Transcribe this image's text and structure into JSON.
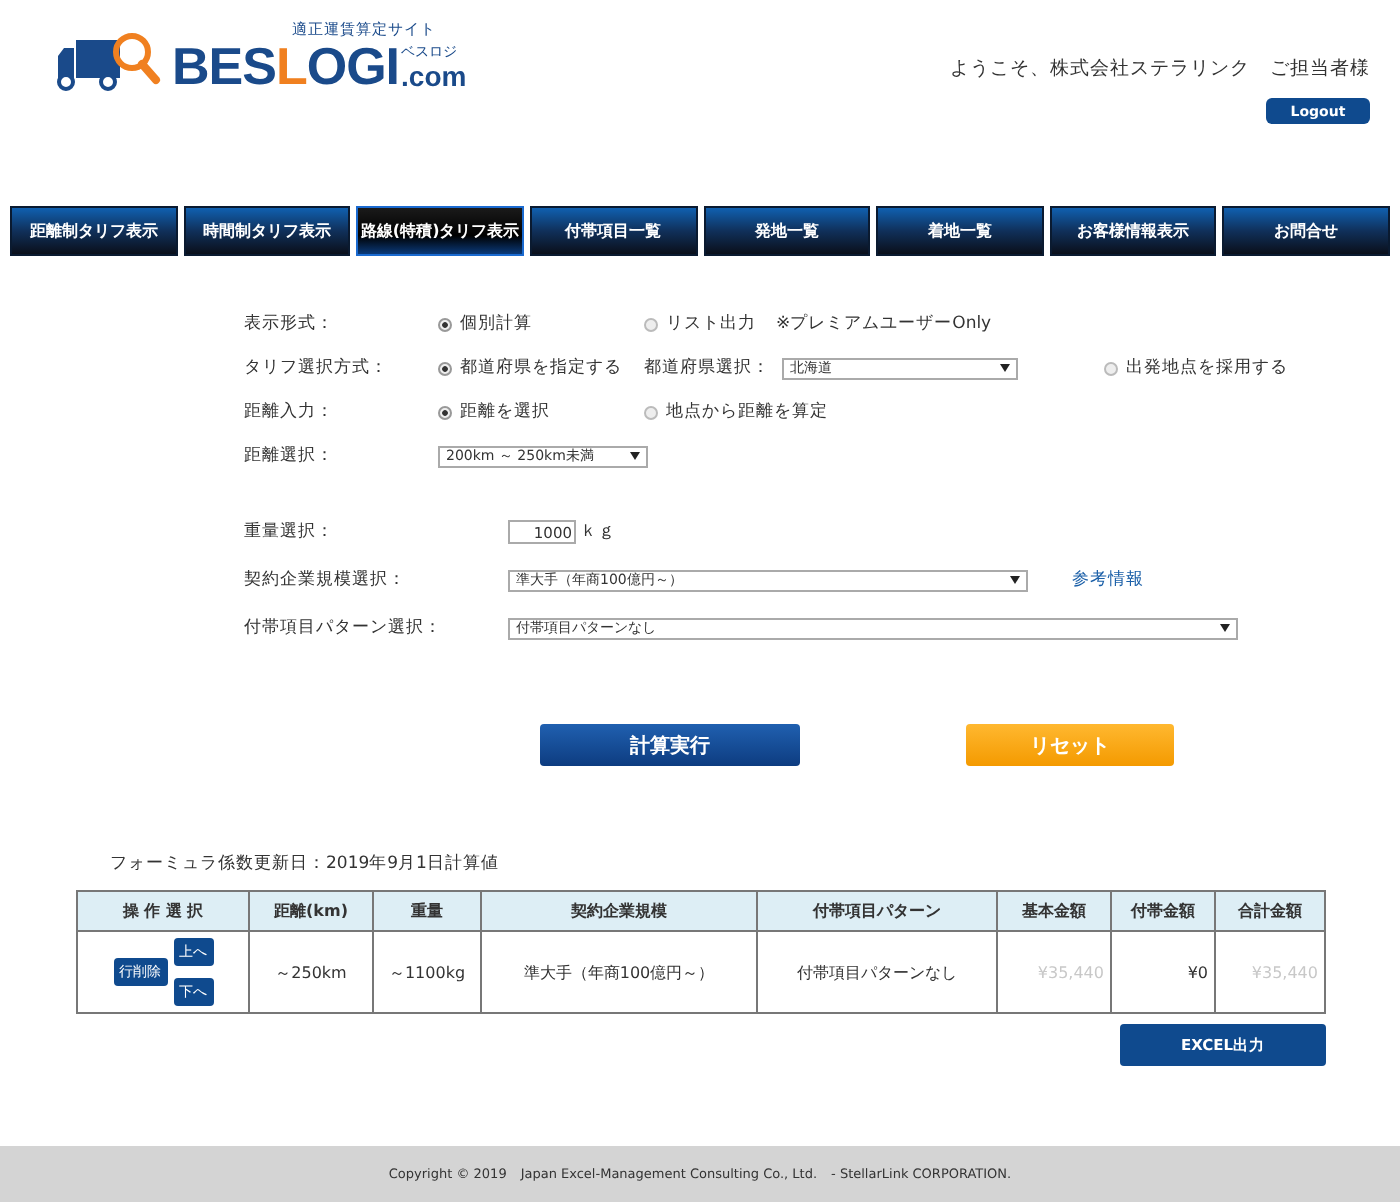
{
  "header": {
    "logo": {
      "tagline": "適正運賃算定サイト",
      "name_before": "BES",
      "name_highlight": "L",
      "name_after": "OGI",
      "suffix": ".com",
      "kana": "ベスロジ"
    },
    "welcome": "ようこそ、株式会社ステラリンク　ご担当者様",
    "logout": "Logout"
  },
  "nav": [
    {
      "label": "距離制タリフ表示",
      "selected": false
    },
    {
      "label": "時間制タリフ表示",
      "selected": false
    },
    {
      "label": "路線(特積)タリフ表示",
      "selected": true
    },
    {
      "label": "付帯項目一覧",
      "selected": false
    },
    {
      "label": "発地一覧",
      "selected": false
    },
    {
      "label": "着地一覧",
      "selected": false
    },
    {
      "label": "お客様情報表示",
      "selected": false
    },
    {
      "label": "お問合せ",
      "selected": false
    }
  ],
  "form": [
    {
      "rows": [
        {
          "label": "表示形式：",
          "items": [
            {
              "kind": "radio",
              "label": "個別計算",
              "selected": true
            },
            {
              "kind": "radio",
              "label": "リスト出力",
              "selected": false
            },
            {
              "kind": "text",
              "text": "※プレミアムユーザーOnly"
            }
          ]
        },
        {
          "label": "タリフ選択方式：",
          "items": [
            {
              "kind": "radio",
              "label": "都道府県を指定する",
              "selected": true
            },
            {
              "kind": "text",
              "text": "都道府県選択："
            },
            {
              "kind": "select",
              "value": "北海道"
            },
            {
              "kind": "radio",
              "label": "出発地点を採用する",
              "selected": false
            }
          ]
        },
        {
          "label": "距離入力：",
          "items": [
            {
              "kind": "radio",
              "label": "距離を選択",
              "selected": true
            },
            {
              "kind": "radio",
              "label": "地点から距離を算定",
              "selected": false
            }
          ]
        },
        {
          "label": "距離選択：",
          "items": [
            {
              "kind": "select",
              "value": "200km ～ 250km未満"
            }
          ]
        }
      ]
    },
    {
      "rows": [
        {
          "label": "重量選択：",
          "items": [
            {
              "kind": "input",
              "value": "1000"
            },
            {
              "kind": "text",
              "text": "ｋｇ"
            }
          ]
        },
        {
          "label": "契約企業規模選択：",
          "items": [
            {
              "kind": "select",
              "value": "準大手（年商100億円～）"
            },
            {
              "kind": "link",
              "text": "参考情報"
            }
          ]
        },
        {
          "label": "付帯項目パターン選択：",
          "items": [
            {
              "kind": "select",
              "value": "付帯項目パターンなし"
            }
          ]
        }
      ]
    }
  ],
  "actions": [
    {
      "label": "計算実行",
      "kind": "primary"
    },
    {
      "label": "リセット",
      "kind": "secondary"
    }
  ],
  "formula_note": "フォーミュラ係数更新日：2019年9月1日計算値",
  "table": {
    "columns": [
      "操 作 選 択",
      "距離(km)",
      "重量",
      "契約企業規模",
      "付帯項目パターン",
      "基本金額",
      "付帯金額",
      "合計金額"
    ],
    "rows": [
      {
        "cells": [
          {
            "buttons": [
              "行削除",
              "上へ",
              "下へ"
            ]
          },
          "～250km",
          "～1100kg",
          "準大手（年商100億円～）",
          "付帯項目パターンなし",
          "¥35,440",
          "¥0",
          "¥35,440"
        ]
      }
    ]
  },
  "excel_button": "EXCEL出力",
  "footer": "Copyright © 2019　Japan Excel-Management Consulting Co., Ltd.　- StellarLink CORPORATION."
}
